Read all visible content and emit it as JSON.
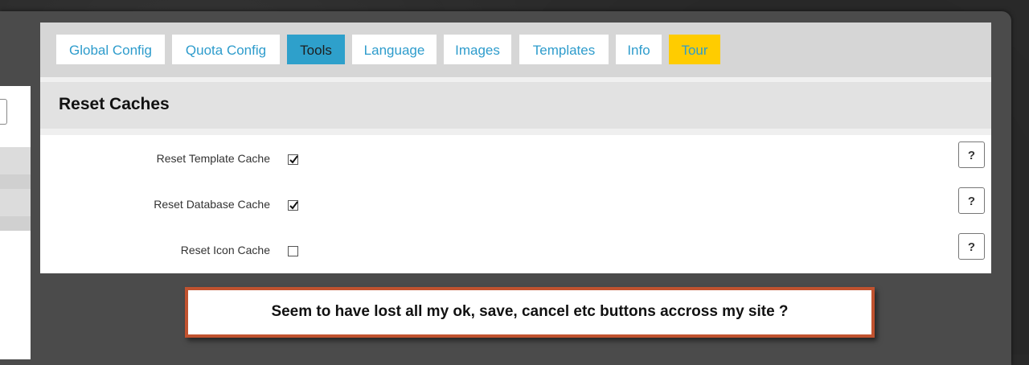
{
  "tabs": [
    {
      "label": "Global Config"
    },
    {
      "label": "Quota Config"
    },
    {
      "label": "Tools"
    },
    {
      "label": "Language"
    },
    {
      "label": "Images"
    },
    {
      "label": "Templates"
    },
    {
      "label": "Info"
    },
    {
      "label": "Tour"
    }
  ],
  "active_tab": "Tools",
  "section": {
    "title": "Reset Caches"
  },
  "options": [
    {
      "label": "Reset Template Cache",
      "checked": true,
      "help": "?"
    },
    {
      "label": "Reset Database Cache",
      "checked": true,
      "help": "?"
    },
    {
      "label": "Reset Icon Cache",
      "checked": false,
      "help": "?"
    }
  ],
  "callout": {
    "text": "Seem to have lost all my ok, save, cancel etc buttons accross my site ?"
  },
  "colors": {
    "tab_text": "#2e9ccc",
    "tab_active_bg": "#2ea0cb",
    "tab_tour_bg": "#ffcc00",
    "callout_border": "#c0522f"
  }
}
